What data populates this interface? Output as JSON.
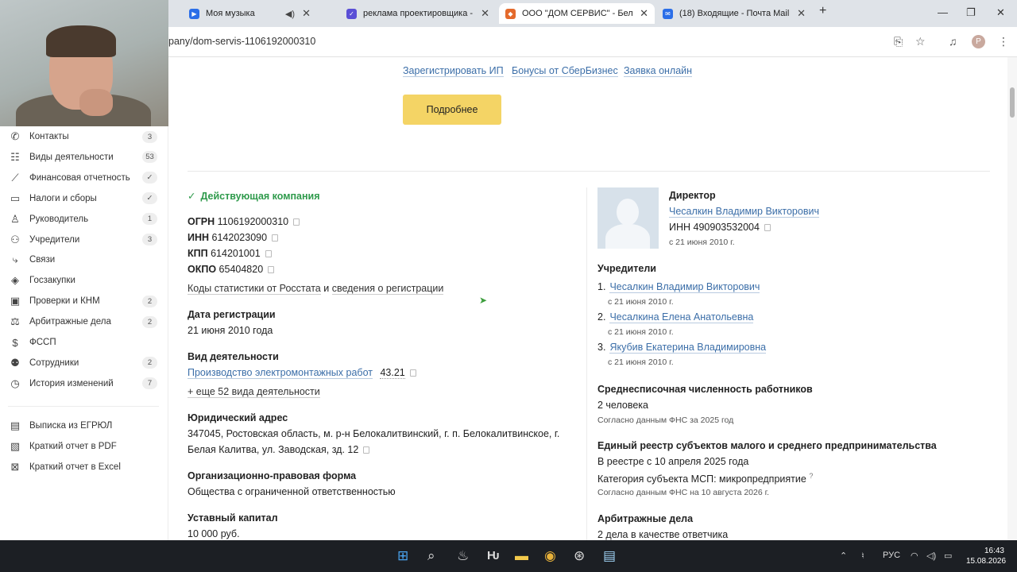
{
  "browser": {
    "tabs": [
      {
        "title": "Моя музыка",
        "fav_color": "#2b6ee8"
      },
      {
        "title": "реклама проектировщика - D",
        "fav_color": "#5a4fd6"
      },
      {
        "title": "ООО \"ДОМ СЕРВИС\" - Белая К",
        "fav_color": "#e46a2c"
      },
      {
        "title": "(18) Входящие - Почта Mail",
        "fav_color": "#2b6ee8"
      }
    ],
    "url": "pany/dom-servis-1106192000310",
    "profile_initial": "P"
  },
  "sidebar": {
    "items": [
      {
        "icon": "phone-icon",
        "glyph": "✆",
        "label": "Контакты",
        "badge": "3"
      },
      {
        "icon": "list-icon",
        "glyph": "☷",
        "label": "Виды деятельности",
        "badge": "53"
      },
      {
        "icon": "chart-line-icon",
        "glyph": "⟋",
        "label": "Финансовая отчетность",
        "badge": "✓"
      },
      {
        "icon": "wallet-icon",
        "glyph": "▭",
        "label": "Налоги и сборы",
        "badge": "✓"
      },
      {
        "icon": "person-icon",
        "glyph": "♙",
        "label": "Руководитель",
        "badge": "1"
      },
      {
        "icon": "people-icon",
        "glyph": "⚇",
        "label": "Учредители",
        "badge": "3"
      },
      {
        "icon": "links-icon",
        "glyph": "⤷",
        "label": "Связи",
        "badge": ""
      },
      {
        "icon": "layers-icon",
        "glyph": "◈",
        "label": "Госзакупки",
        "badge": ""
      },
      {
        "icon": "calendar-check-icon",
        "glyph": "▣",
        "label": "Проверки и КНМ",
        "badge": "2"
      },
      {
        "icon": "gavel-icon",
        "glyph": "⚖",
        "label": "Арбитражные дела",
        "badge": "2"
      },
      {
        "icon": "coin-icon",
        "glyph": "$",
        "label": "ФССП",
        "badge": ""
      },
      {
        "icon": "staff-icon",
        "glyph": "⚉",
        "label": "Сотрудники",
        "badge": "2"
      },
      {
        "icon": "history-icon",
        "glyph": "◷",
        "label": "История изменений",
        "badge": "7"
      }
    ],
    "exports": [
      {
        "icon": "document-icon",
        "glyph": "▤",
        "label": "Выписка из ЕГРЮЛ"
      },
      {
        "icon": "pdf-icon",
        "glyph": "▧",
        "label": "Краткий отчет в PDF"
      },
      {
        "icon": "excel-icon",
        "glyph": "⊠",
        "label": "Краткий отчет в Excel"
      }
    ]
  },
  "top_links": [
    "Зарегистрировать ИП",
    "Бонусы от СберБизнес",
    "Заявка онлайн"
  ],
  "more_button": "Подробнее",
  "company": {
    "status": "Действующая компания",
    "ogrn_label": "ОГРН",
    "ogrn": "1106192000310",
    "inn_label": "ИНН",
    "inn": "6142023090",
    "kpp_label": "КПП",
    "kpp": "614201001",
    "okpo_label": "ОКПО",
    "okpo": "65404820",
    "stats_link": "Коды статистики от Росстата",
    "stats_and": "и",
    "reg_link": "сведения о регистрации",
    "reg_date_label": "Дата регистрации",
    "reg_date": "21 июня 2010 года",
    "activity_label": "Вид деятельности",
    "activity": "Производство электромонтажных работ",
    "activity_code": "43.21",
    "more_activities": "+ еще 52 вида деятельности",
    "address_label": "Юридический адрес",
    "address_line1": "347045, Ростовская область, м. р-н Белокалитвинский, г. п. Белокалитвинское, г.",
    "address_line2": "Белая Калитва, ул. Заводская, зд. 12",
    "legal_form_label": "Организационно-правовая форма",
    "legal_form": "Общества с ограниченной ответственностью",
    "capital_label": "Уставный капитал",
    "capital": "10 000 руб."
  },
  "director": {
    "label": "Директор",
    "name": "Чесалкин Владимир Викторович",
    "inn": "ИНН 490903532004",
    "since": "с 21 июня 2010 г."
  },
  "founders": {
    "label": "Учредители",
    "items": [
      {
        "num": "1.",
        "name": "Чесалкин Владимир Викторович",
        "since": "с 21 июня 2010 г."
      },
      {
        "num": "2.",
        "name": "Чесалкина Елена Анатольевна",
        "since": "с 21 июня 2010 г."
      },
      {
        "num": "3.",
        "name": "Якубив Екатерина Владимировна",
        "since": "с 21 июня 2010 г."
      }
    ]
  },
  "employees": {
    "label": "Среднесписочная численность работников",
    "value": "2 человека",
    "note": "Согласно данным ФНС за 2025 год"
  },
  "msp": {
    "label": "Единый реестр субъектов малого и среднего предпринимательства",
    "since": "В реестре с 10 апреля 2025 года",
    "category": "Категория субъекта МСП: микропредприятие",
    "hint": "?",
    "note": "Согласно данным ФНС на 10 августа 2026 г."
  },
  "arbitration": {
    "label": "Арбитражные дела",
    "value": "2 дела в качестве ответчика"
  },
  "taskbar": {
    "lang": "РУС",
    "time": "16:43",
    "date": "15.08.2026"
  }
}
